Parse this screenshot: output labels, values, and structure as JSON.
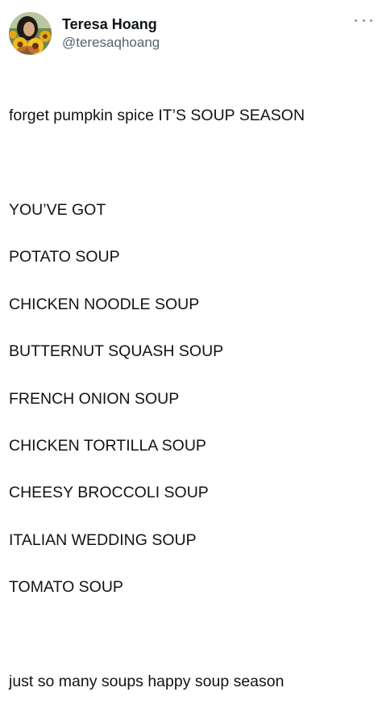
{
  "tweet": {
    "author": {
      "display_name": "Teresa Hoang",
      "handle": "@teresaqhoang",
      "avatar_icon": "profile-photo-sunflowers"
    },
    "more_icon": "more-options-icon",
    "lines": [
      "forget pumpkin spice IT’S SOUP SEASON",
      "",
      "YOU’VE GOT",
      "POTATO SOUP",
      "CHICKEN NOODLE SOUP",
      "BUTTERNUT SQUASH SOUP",
      "FRENCH ONION SOUP",
      "CHICKEN TORTILLA SOUP",
      "CHEESY BROCCOLI SOUP",
      "ITALIAN WEDDING SOUP",
      "TOMATO SOUP",
      "",
      "just so many soups happy soup season"
    ]
  },
  "colors": {
    "text": "#0f1419",
    "secondary_text": "#536471",
    "icon_gray": "#8b98a5",
    "background": "#ffffff"
  }
}
